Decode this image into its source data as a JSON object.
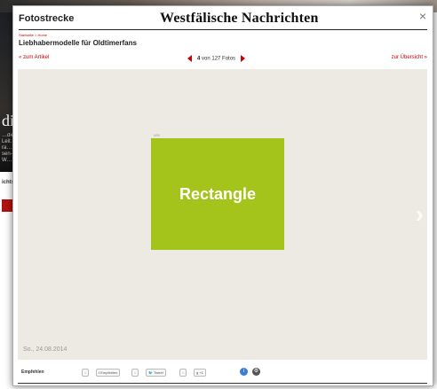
{
  "background": {
    "left_headline_fragment": "die",
    "left_small_text": "…die Leit… ra… sen-W…",
    "left_label": "ichts"
  },
  "gallery": {
    "title": "Fotostrecke",
    "logo": "Westfälische Nachrichten",
    "close_label": "×",
    "breadcrumb": "Startseite > Home",
    "subtitle": "Liebhabermodelle für Oldtimerfans",
    "back_label": "« zum Artikel",
    "counter_current": "4",
    "counter_rest": "von 127 Fotos",
    "forward_label": "zur Übersicht »",
    "next_glyph": "›",
    "image_credit": "WN",
    "image_label": "Rectangle",
    "date": "So., 24.08.2014",
    "accent_color": "#cc0000",
    "image_color": "#a4c41b"
  },
  "toolbar": {
    "share_label": "Empfehlen",
    "recommend_label": "Empfehlen",
    "tweet_label": "Tweet",
    "gplus_label": "+1",
    "info_label": "i",
    "settings_label": "⚙"
  }
}
